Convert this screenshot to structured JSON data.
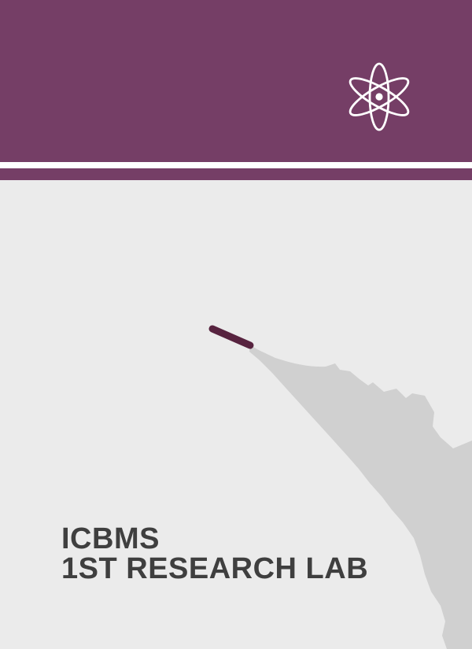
{
  "cover": {
    "title_line1": "ICBMS",
    "title_line2": "1ST RESEARCH LAB"
  },
  "icons": {
    "header_icon": "atom-icon",
    "illustration": "pen-nib-illustration"
  },
  "colors": {
    "accent": "#753e66",
    "background": "#ebebeb",
    "illustration_gray": "#d0d0d0",
    "pen_tip": "#57233f",
    "title_text": "#3f3f3f"
  }
}
